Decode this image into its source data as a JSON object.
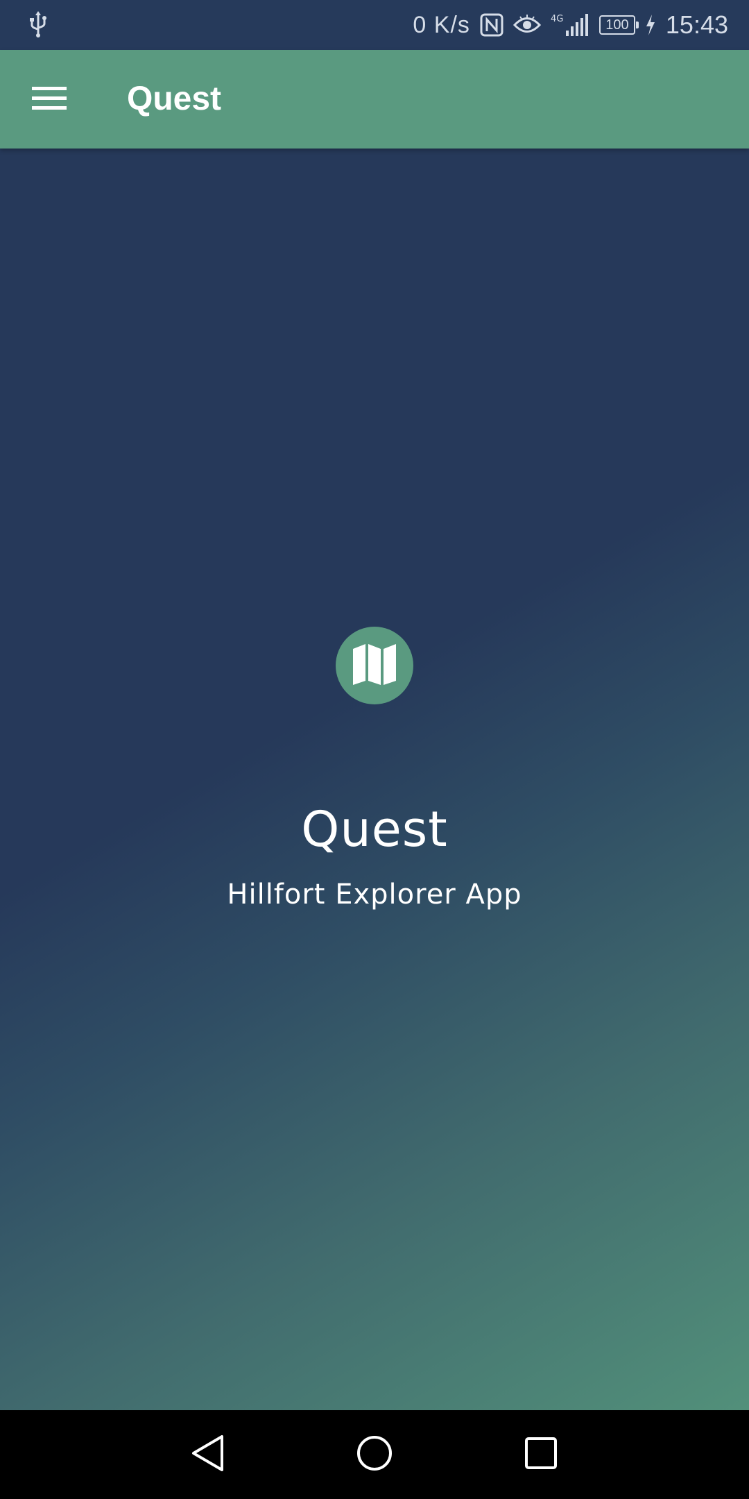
{
  "status_bar": {
    "network_speed": "0 K/s",
    "network_type": "4G",
    "battery_level": "100",
    "time": "15:43",
    "icons": [
      "usb-icon",
      "nfc-icon",
      "eye-icon",
      "signal-icon",
      "battery-icon",
      "charging-icon"
    ]
  },
  "app_bar": {
    "title": "Quest",
    "menu_icon": "hamburger-menu-icon"
  },
  "main": {
    "logo_icon": "map-icon",
    "title": "Quest",
    "subtitle": "Hillfort Explorer App"
  },
  "nav_bar": {
    "buttons": [
      "back-icon",
      "home-icon",
      "recent-apps-icon"
    ]
  },
  "colors": {
    "status_bar": "#263a5b",
    "app_bar": "#5a9a80",
    "background_top": "#26395a",
    "background_bottom": "#52907a",
    "text": "#ffffff",
    "nav_bar": "#000000"
  }
}
